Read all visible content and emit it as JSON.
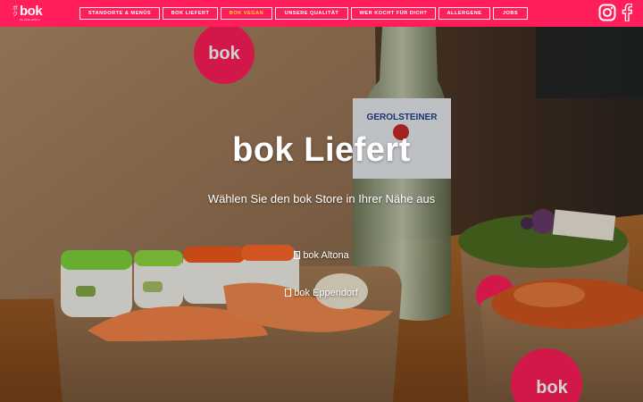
{
  "brand": {
    "name": "bok",
    "tagline": "the asian kitchen"
  },
  "nav": [
    {
      "label": "Standorte & Menüs"
    },
    {
      "label": "bok Liefert"
    },
    {
      "label": "bok Vegan"
    },
    {
      "label": "Unsere Qualität"
    },
    {
      "label": "Wer kocht für dich?"
    },
    {
      "label": "Allergene"
    },
    {
      "label": "Jobs"
    }
  ],
  "social": {
    "instagram": "instagram-icon",
    "facebook": "facebook-icon"
  },
  "hero": {
    "title": "bok Liefert",
    "subtitle": "Wählen Sie den bok Store in Ihrer Nähe aus",
    "stores": [
      {
        "label": "bok Altona"
      },
      {
        "label": "bok Eppendorf"
      }
    ]
  },
  "colors": {
    "brand": "#ff1e5a",
    "active_nav": "#ffd233"
  }
}
